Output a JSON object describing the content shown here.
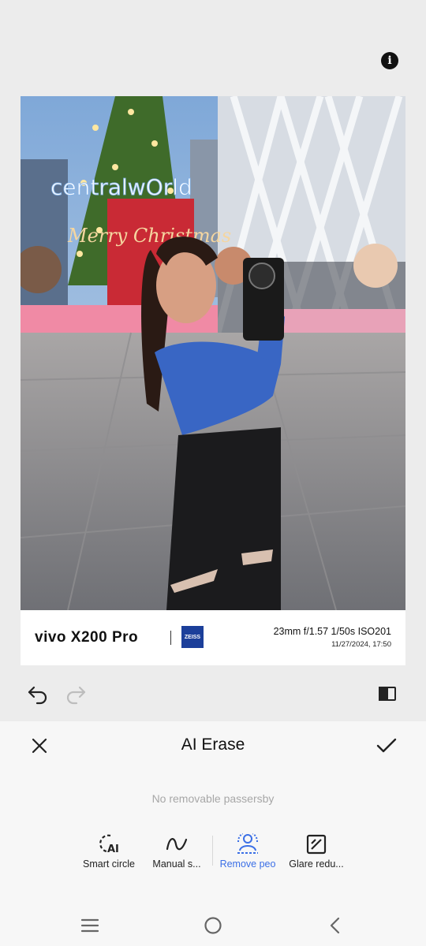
{
  "header": {
    "info_icon": "info-icon"
  },
  "photo": {
    "description_hidden": "",
    "watermark": {
      "brand": "vivo X200 Pro",
      "badge": "ZEISS",
      "exif": "23mm  f/1.57  1/50s  ISO201",
      "datetime": "11/27/2024, 17:50"
    },
    "sign_text": "centralwOrld"
  },
  "edit_toolbar": {
    "undo_icon": "undo-icon",
    "redo_icon": "redo-icon",
    "compare_icon": "compare-icon"
  },
  "sheet": {
    "title": "AI Erase",
    "close_icon": "close-icon",
    "confirm_icon": "check-icon",
    "hint": "No removable passersby",
    "tools": [
      {
        "label": "Smart circle",
        "icon": "smart-circle-icon",
        "active": false
      },
      {
        "label": "Manual s...",
        "icon": "manual-select-icon",
        "active": false
      },
      {
        "label": "Remove peo",
        "icon": "remove-people-icon",
        "active": true
      },
      {
        "label": "Glare redu...",
        "icon": "glare-reduction-icon",
        "active": false
      }
    ],
    "accent_color": "#3b6fe6"
  },
  "navbar": {
    "menu_icon": "menu-icon",
    "home_icon": "home-icon",
    "back_icon": "back-icon"
  }
}
